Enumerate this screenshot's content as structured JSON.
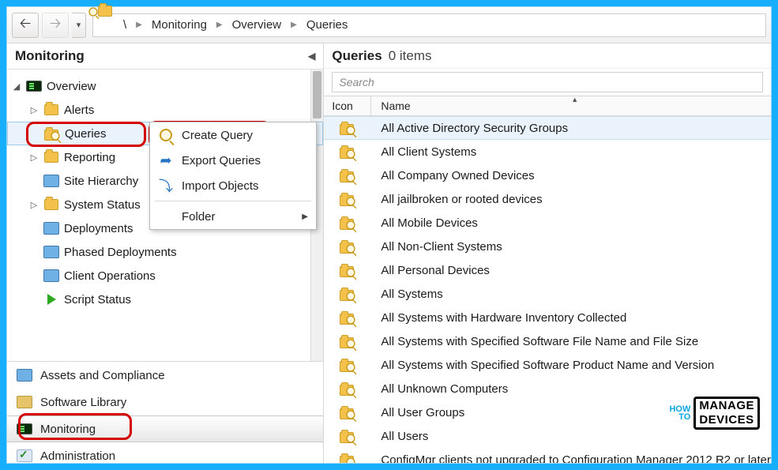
{
  "breadcrumb": {
    "root": "\\",
    "b1": "Monitoring",
    "b2": "Overview",
    "b3": "Queries"
  },
  "left": {
    "title": "Monitoring",
    "tree": {
      "root": "Overview",
      "items": [
        {
          "label": "Alerts"
        },
        {
          "label": "Queries"
        },
        {
          "label": "Reporting"
        },
        {
          "label": "Site Hierarchy"
        },
        {
          "label": "System Status"
        },
        {
          "label": "Deployments"
        },
        {
          "label": "Phased Deployments"
        },
        {
          "label": "Client Operations"
        },
        {
          "label": "Script Status"
        }
      ]
    },
    "nav": {
      "n0": "Assets and Compliance",
      "n1": "Software Library",
      "n2": "Monitoring",
      "n3": "Administration"
    }
  },
  "ctx": {
    "c0": "Create Query",
    "c1": "Export Queries",
    "c2": "Import Objects",
    "c3": "Folder"
  },
  "right": {
    "title": "Queries",
    "count": "0 items",
    "search_ph": "Search",
    "col_icon": "Icon",
    "col_name": "Name",
    "rows": [
      "All Active Directory Security Groups",
      "All Client Systems",
      "All Company Owned Devices",
      "All jailbroken or rooted devices",
      "All Mobile Devices",
      "All Non-Client Systems",
      "All Personal Devices",
      "All Systems",
      "All Systems with Hardware Inventory Collected",
      "All Systems with Specified Software File Name and File Size",
      "All Systems with Specified Software Product Name and Version",
      "All Unknown Computers",
      "All User Groups",
      "All Users",
      "ConfigMgr clients not upgraded to Configuration Manager 2012 R2 or later"
    ]
  },
  "watermark": {
    "how": "HOW",
    "to": "TO",
    "lineA": "MANAGE",
    "lineB": "DEVICES"
  }
}
